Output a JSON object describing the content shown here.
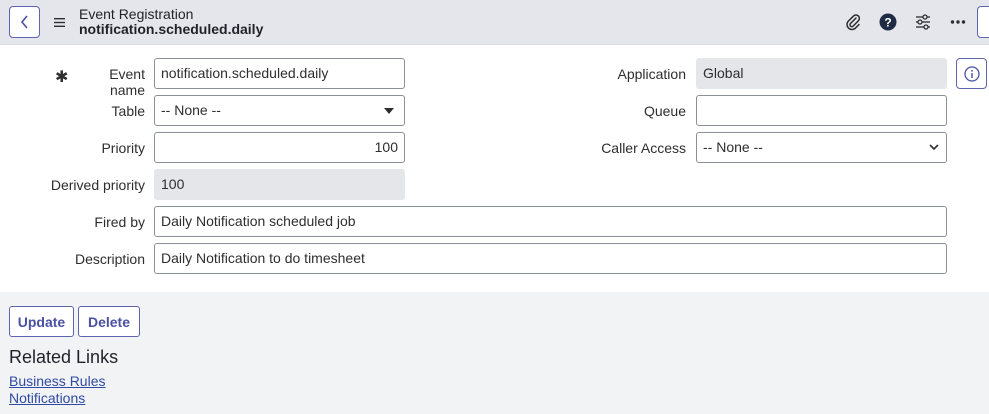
{
  "header": {
    "title_line1": "Event Registration",
    "title_line2": "notification.scheduled.daily",
    "icons": [
      "back-icon",
      "menu-icon",
      "paperclip-icon",
      "help-icon",
      "settings-sliders-icon",
      "more-icon"
    ]
  },
  "form": {
    "event_name": {
      "label": "Event name",
      "value": "notification.scheduled.daily",
      "mandatory": true
    },
    "table": {
      "label": "Table",
      "value": "-- None --"
    },
    "priority": {
      "label": "Priority",
      "value": "100"
    },
    "derived_priority": {
      "label": "Derived priority",
      "value": "100"
    },
    "fired_by": {
      "label": "Fired by",
      "value": "Daily Notification scheduled job"
    },
    "description": {
      "label": "Description",
      "value": "Daily Notification to do timesheet"
    },
    "application": {
      "label": "Application",
      "value": "Global"
    },
    "queue": {
      "label": "Queue",
      "value": ""
    },
    "caller_access": {
      "label": "Caller Access",
      "value": "-- None --"
    }
  },
  "actions": {
    "update_label": "Update",
    "delete_label": "Delete"
  },
  "related": {
    "title": "Related Links",
    "links": [
      "Business Rules",
      "Notifications"
    ]
  },
  "colors": {
    "header_bg": "#e4e6eb",
    "accent": "#5e64b0",
    "link": "#2f4aa3",
    "readonly_bg": "#e4e6ea",
    "footer_bg": "#f2f3f5"
  }
}
